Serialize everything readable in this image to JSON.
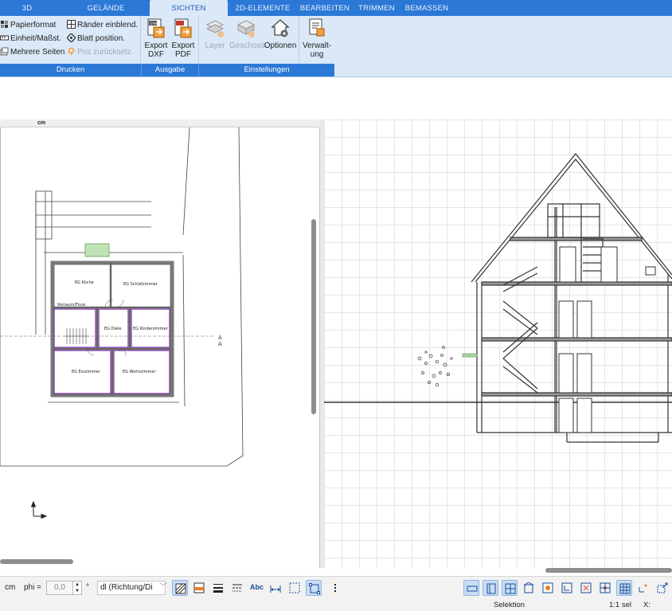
{
  "tabs": [
    {
      "label": "3D",
      "active": false
    },
    {
      "label": "GELÄNDE",
      "active": false
    },
    {
      "label": "SICHTEN",
      "active": true
    },
    {
      "label": "2D-ELEMENTE",
      "active": false
    },
    {
      "label": "BEARBEITEN",
      "active": false
    },
    {
      "label": "TRIMMEN",
      "active": false
    },
    {
      "label": "BEMASSEN",
      "active": false
    }
  ],
  "ribbon": {
    "drucken": {
      "label": "Drucken",
      "papierformat": "Papierformat",
      "einheit": "Einheit/Maßst.",
      "mehrere_seiten": "Mehrere Seiten",
      "raender": "Ränder einblend.",
      "blatt": "Blatt position.",
      "pos_reset": "Pos zurücksetz."
    },
    "ausgabe": {
      "label": "Ausgabe",
      "export_dxf_1": "Export",
      "export_dxf_2": "DXF",
      "export_pdf_1": "Export",
      "export_pdf_2": "PDF"
    },
    "einstellungen": {
      "label": "Einstellungen",
      "layer": "Layer",
      "geschoss": "Geschoss",
      "optionen": "Optionen",
      "verwaltung_1": "Verwalt-",
      "verwaltung_2": "ung"
    }
  },
  "plan": {
    "unit": "cm",
    "rooms": [
      "EG Küche",
      "EG Schlafzimmer",
      "Vorraum/Flure",
      "EG Diele",
      "EG Kinderzimmer",
      "EG Esszimmer",
      "EG Wohnzimmer"
    ],
    "section_marker": "A"
  },
  "bottom": {
    "unit": "cm",
    "phi_label": "phi =",
    "phi_value": "0,0",
    "degree": "°",
    "direction_select": "dl (Richtung/Di",
    "text_tool": "Abc"
  },
  "status": {
    "mode": "Selektion",
    "selection": "1:1 sel",
    "x_label": "X:"
  }
}
